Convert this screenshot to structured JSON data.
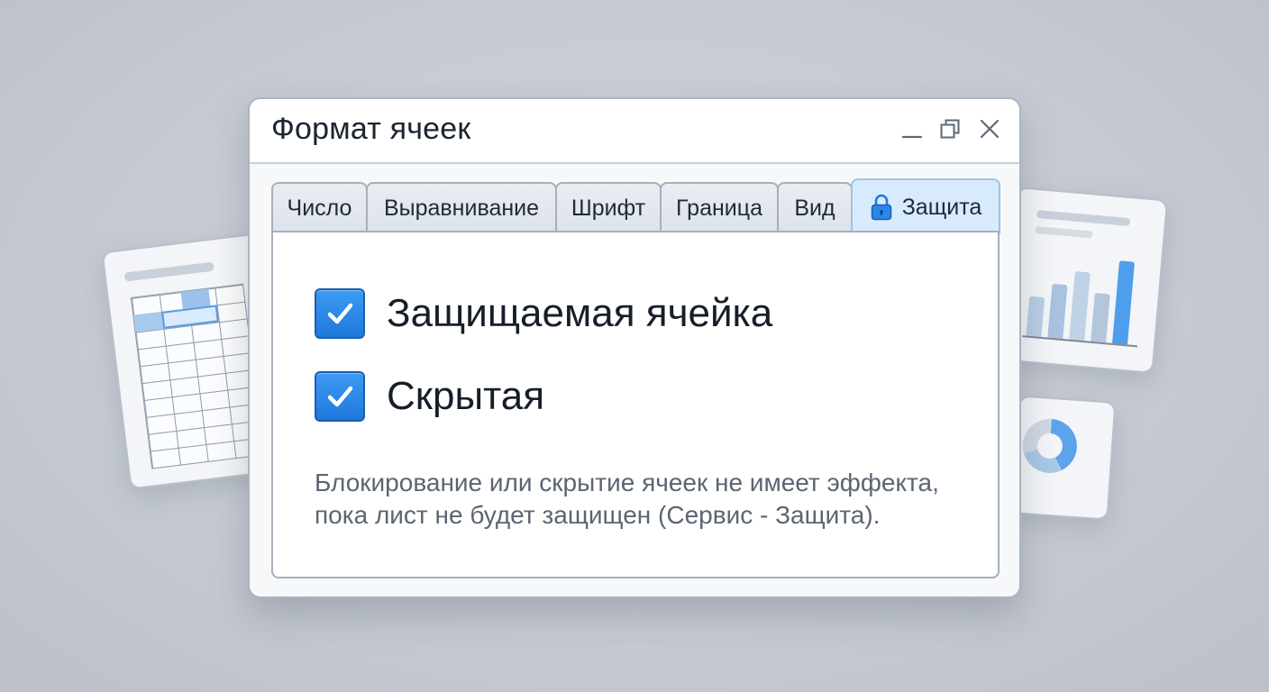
{
  "window": {
    "title": "Формат ячеек",
    "controls": [
      "minimize-icon",
      "maximize-icon",
      "close-icon"
    ]
  },
  "tabs": [
    {
      "label": "Число",
      "active": false
    },
    {
      "label": "Выравнивание",
      "active": false
    },
    {
      "label": "Шрифт",
      "active": false
    },
    {
      "label": "Граница",
      "active": false
    },
    {
      "label": "Вид",
      "active": false
    },
    {
      "label": "Защита",
      "active": true,
      "icon": "lock-icon"
    }
  ],
  "protection": {
    "options": [
      {
        "label": "Защищаемая ячейка",
        "checked": true
      },
      {
        "label": "Скрытая",
        "checked": true
      }
    ],
    "note_lines": [
      "Блокирование или скрытие ячеек не имеет эффекта,",
      "пока лист не будет защищен (Сервис - Защита)."
    ]
  },
  "colors": {
    "accent": "#2a86e8",
    "active_tab": "#d8ebfc",
    "note_text": "#5b6573"
  }
}
